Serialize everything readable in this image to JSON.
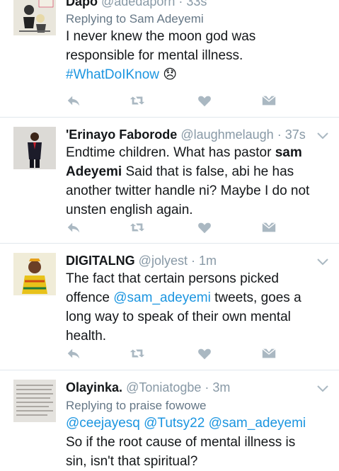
{
  "tweets": [
    {
      "name": "Dapo",
      "handle": "@adedaporn",
      "time": "33s",
      "reply_to": "Replying to Sam Adeyemi",
      "line1": "I never knew the moon god was",
      "line2": "responsible for mental illness.",
      "hashtag": "#WhatDoIKnow",
      "emoji": "😞"
    },
    {
      "name": "'Erinayo Faborode",
      "handle": "@laughmelaugh",
      "time": "37s",
      "line1_a": "Endtime children. What has pastor ",
      "line1_b": "sam",
      "line2_a": "Adeyemi",
      "line2_b": " Said that is false, abi he has",
      "line3": "another twitter handle ni? Maybe I do not",
      "line4": "unsten english again."
    },
    {
      "name": "DIGITALNG",
      "handle": "@jolyest",
      "time": "1m",
      "line1": "The fact that certain persons picked",
      "line2_a": "offence ",
      "mention": "@sam_adeyemi",
      "line2_b": " tweets, goes a",
      "line3": "long way to speak of their own mental",
      "line4": "health."
    },
    {
      "name": "Olayinka.",
      "handle": "@Toniatogbe",
      "time": "3m",
      "reply_to": "Replying to praise fowowe",
      "mention1": "@ceejayesq",
      "mention2": "@Tutsy22",
      "mention3": "@sam_adeyemi",
      "line2": "So if the root cause of mental illness is",
      "line3": "sin, isn't that spiritual?"
    }
  ],
  "sep": " · ",
  "colors": {
    "link": "#1b95e0",
    "muted": "#8899a6",
    "icon": "#aab8c2"
  }
}
